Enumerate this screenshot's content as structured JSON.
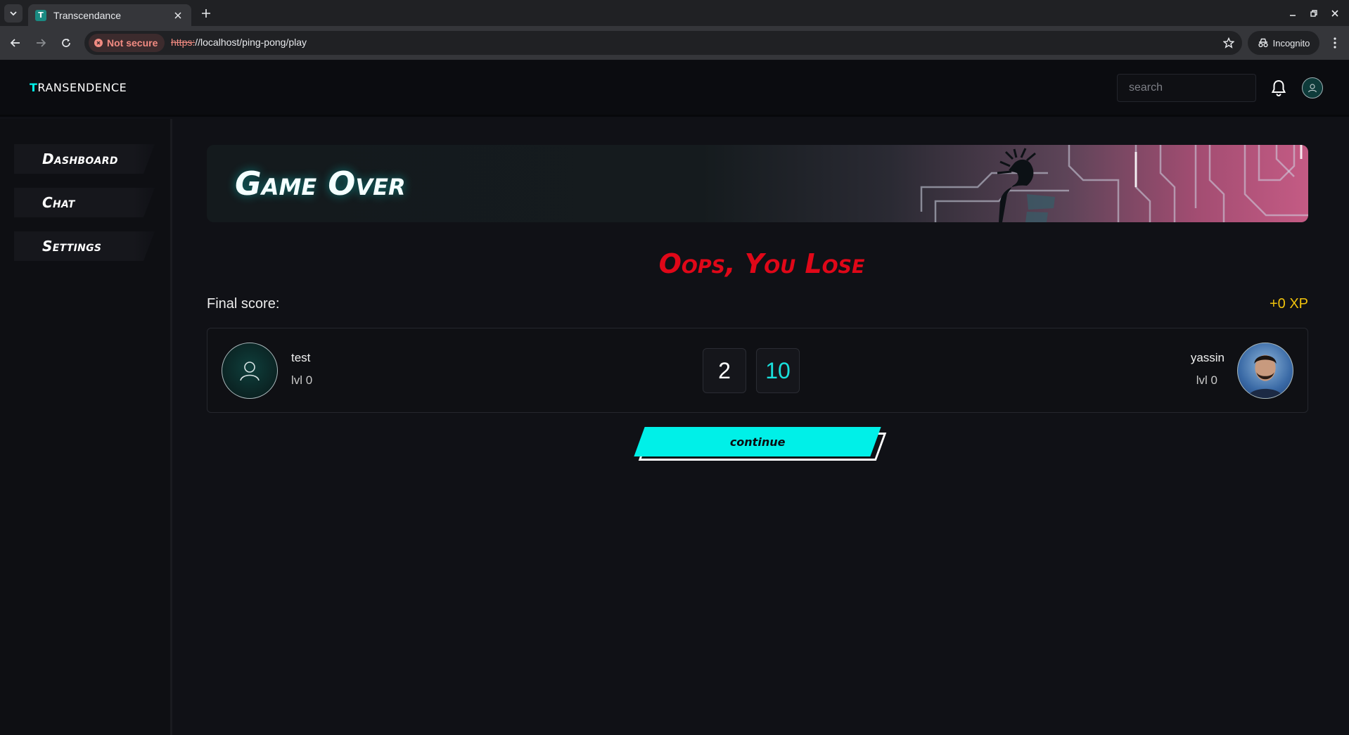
{
  "browser": {
    "tab_favicon": "T",
    "tab_title": "Transcendance",
    "security_label": "Not secure",
    "url_scheme": "https:",
    "url_rest": "//localhost/ping-pong/play",
    "incognito_label": "Incognito"
  },
  "header": {
    "logo_first": "T",
    "logo_rest": "RANSENDENCE",
    "search_placeholder": "search"
  },
  "sidebar": {
    "items": [
      {
        "label": "Dashboard"
      },
      {
        "label": "Chat"
      },
      {
        "label": "Settings"
      }
    ]
  },
  "game": {
    "banner_title": "Game Over",
    "result": "Oops, You Lose",
    "final_score_label": "Final score:",
    "xp_gain": "+0 XP",
    "player1": {
      "name": "test",
      "level": "lvl 0",
      "score": "2"
    },
    "player2": {
      "name": "yassin",
      "level": "lvl 0",
      "score": "10"
    },
    "continue_label": "continue"
  },
  "colors": {
    "accent": "#00f0e8",
    "lose_red": "#e00718",
    "xp_gold": "#f0c20c",
    "background": "#101116"
  },
  "icons": {
    "bell": "bell-icon",
    "user": "user-icon",
    "star": "star-icon",
    "incognito": "incognito-icon"
  }
}
